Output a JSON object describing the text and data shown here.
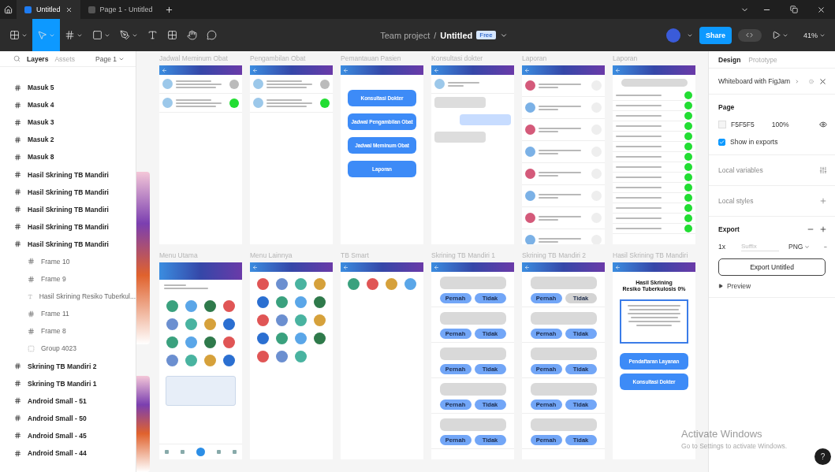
{
  "tabs": [
    {
      "label": "Untitled",
      "selected": true
    },
    {
      "label": "Page 1 - Untitled",
      "selected": false
    }
  ],
  "tools": [
    {
      "kind": "menu",
      "selected": false
    },
    {
      "kind": "move",
      "selected": true
    },
    {
      "kind": "frame",
      "selected": false
    },
    {
      "kind": "shape",
      "selected": false
    },
    {
      "kind": "pen",
      "selected": false
    },
    {
      "kind": "text",
      "selected": false
    },
    {
      "kind": "resources",
      "selected": false
    },
    {
      "kind": "hand",
      "selected": false
    },
    {
      "kind": "comment",
      "selected": false
    }
  ],
  "file": {
    "project": "Team project",
    "separator": "/",
    "name": "Untitled",
    "plan": "Free"
  },
  "actions": {
    "share": "Share",
    "dev_mode": false,
    "zoom": "41%"
  },
  "layers_panel": {
    "tabs": [
      {
        "label": "Layers",
        "selected": true
      },
      {
        "label": "Assets",
        "selected": false
      }
    ],
    "page": "Page 1",
    "items": [
      {
        "label": "Masuk 5",
        "kind": "frame"
      },
      {
        "label": "Masuk 4",
        "kind": "frame"
      },
      {
        "label": "Masuk 3",
        "kind": "frame"
      },
      {
        "label": "Masuk 2",
        "kind": "frame"
      },
      {
        "label": "Masuk 8",
        "kind": "frame"
      },
      {
        "label": "Hasil Skrining TB Mandiri",
        "kind": "frame"
      },
      {
        "label": "Hasil Skrining TB Mandiri",
        "kind": "frame"
      },
      {
        "label": "Hasil Skrining TB Mandiri",
        "kind": "frame"
      },
      {
        "label": "Hasil Skrining TB Mandiri",
        "kind": "frame"
      },
      {
        "label": "Hasil Skrining TB Mandiri",
        "kind": "frame",
        "children": [
          {
            "label": "Frame 10",
            "kind": "frame"
          },
          {
            "label": "Frame 9",
            "kind": "frame"
          },
          {
            "label": "Hasil Skrining Resiko Tuberkul...",
            "kind": "text"
          },
          {
            "label": "Frame 11",
            "kind": "frame"
          },
          {
            "label": "Frame 8",
            "kind": "frame"
          },
          {
            "label": "Group 4023",
            "kind": "group"
          }
        ]
      },
      {
        "label": "Skrining TB Mandiri 2",
        "kind": "frame"
      },
      {
        "label": "Skrining TB Mandiri 1",
        "kind": "frame"
      },
      {
        "label": "Android Small - 51",
        "kind": "frame"
      },
      {
        "label": "Android Small - 50",
        "kind": "frame"
      },
      {
        "label": "Android Small - 45",
        "kind": "frame"
      },
      {
        "label": "Android Small - 44",
        "kind": "frame"
      }
    ]
  },
  "canvas": {
    "rows": [
      {
        "frames": [
          {
            "title": "Jadwal Meminum Obat",
            "kind": "notifications",
            "items": [
              {
                "done": false
              },
              {
                "done": true
              }
            ]
          },
          {
            "title": "Pengambilan Obat",
            "kind": "notifications",
            "items": [
              {
                "done": false
              },
              {
                "done": true
              }
            ]
          },
          {
            "title": "Pemantauan Pasien",
            "kind": "menu",
            "buttons": [
              "Konsultasi Dokter",
              "Jadwal Pengambilan Obat",
              "Jadwal Meminum Obat",
              "Laporan"
            ]
          },
          {
            "title": "Konsultasi dokter",
            "kind": "chat",
            "messages": [
              {
                "kind": "received"
              },
              {
                "kind": "sent"
              },
              {
                "kind": "received"
              }
            ]
          },
          {
            "title": "Laporan",
            "kind": "reports",
            "rows": [
              {
                "kind": "usage"
              },
              {
                "kind": "pickup"
              },
              {
                "kind": "usage"
              },
              {
                "kind": "pickup"
              },
              {
                "kind": "usage"
              },
              {
                "kind": "pickup"
              },
              {
                "kind": "usage"
              },
              {
                "kind": "pickup"
              }
            ]
          },
          {
            "title": "Laporan",
            "kind": "schedule",
            "rows": [
              {
                "done": true
              },
              {
                "done": true
              },
              {
                "done": true
              },
              {
                "done": true
              },
              {
                "done": true
              },
              {
                "done": true
              },
              {
                "done": true
              },
              {
                "done": true
              },
              {
                "done": true
              },
              {
                "done": true
              },
              {
                "done": true
              },
              {
                "done": true
              },
              {
                "done": true
              },
              {
                "done": true
              }
            ]
          }
        ]
      },
      {
        "frames": [
          {
            "title": "Menu Utama",
            "kind": "home"
          },
          {
            "title": "Menu Lainnya",
            "kind": "more"
          },
          {
            "title": "TB Smart",
            "kind": "shortcuts"
          },
          {
            "title": "Skrining TB Mandiri 1",
            "kind": "survey",
            "questions": [
              {
                "options": [
                  {
                    "label": "Pernah",
                    "disabled": false
                  },
                  {
                    "label": "Tidak",
                    "disabled": false
                  }
                ]
              },
              {
                "options": [
                  {
                    "label": "Pernah",
                    "disabled": false
                  },
                  {
                    "label": "Tidak",
                    "disabled": false
                  }
                ]
              },
              {
                "options": [
                  {
                    "label": "Pernah",
                    "disabled": false
                  },
                  {
                    "label": "Tidak",
                    "disabled": false
                  }
                ]
              },
              {
                "options": [
                  {
                    "label": "Pernah",
                    "disabled": false
                  },
                  {
                    "label": "Tidak",
                    "disabled": false
                  }
                ]
              },
              {
                "options": [
                  {
                    "label": "Pernah",
                    "disabled": false
                  },
                  {
                    "label": "Tidak",
                    "disabled": false
                  }
                ]
              }
            ]
          },
          {
            "title": "Skrining TB Mandiri 2",
            "kind": "survey",
            "questions": [
              {
                "options": [
                  {
                    "label": "Pernah",
                    "disabled": false
                  },
                  {
                    "label": "Tidak",
                    "disabled": true
                  }
                ]
              },
              {
                "options": [
                  {
                    "label": "Pernah",
                    "disabled": false
                  },
                  {
                    "label": "Tidak",
                    "disabled": false
                  }
                ]
              },
              {
                "options": [
                  {
                    "label": "Pernah",
                    "disabled": false
                  },
                  {
                    "label": "Tidak",
                    "disabled": false
                  }
                ]
              },
              {
                "options": [
                  {
                    "label": "Pernah",
                    "disabled": false
                  },
                  {
                    "label": "Tidak",
                    "disabled": false
                  }
                ]
              },
              {
                "options": [
                  {
                    "label": "Pernah",
                    "disabled": false
                  },
                  {
                    "label": "Tidak",
                    "disabled": false
                  }
                ]
              }
            ]
          },
          {
            "title": "Hasil Skrining TB Mandiri",
            "kind": "result",
            "heading": [
              "Hasil Skrining",
              "Resiko Tuberkulosis 0%"
            ],
            "buttons": [
              "Pendaftaran Layanan",
              "Konsultasi Dokter"
            ]
          }
        ]
      }
    ]
  },
  "design_panel": {
    "tabs": [
      {
        "label": "Design",
        "selected": true
      },
      {
        "label": "Prototype",
        "selected": false
      }
    ],
    "banner": "Whiteboard with FigJam",
    "page": {
      "title": "Page",
      "fill_hex": "F5F5F5",
      "opacity": "100%",
      "show_in_exports": {
        "label": "Show in exports",
        "checked": true
      }
    },
    "sections": [
      "Local variables",
      "Local styles"
    ],
    "export": {
      "title": "Export",
      "scale": "1x",
      "suffix_placeholder": "Suffix",
      "format": "PNG",
      "button": "Export Untitled",
      "preview": "Preview"
    }
  },
  "watermark_os": {
    "title": "Activate Windows",
    "subtitle": "Go to Settings to activate Windows."
  },
  "help": "?"
}
